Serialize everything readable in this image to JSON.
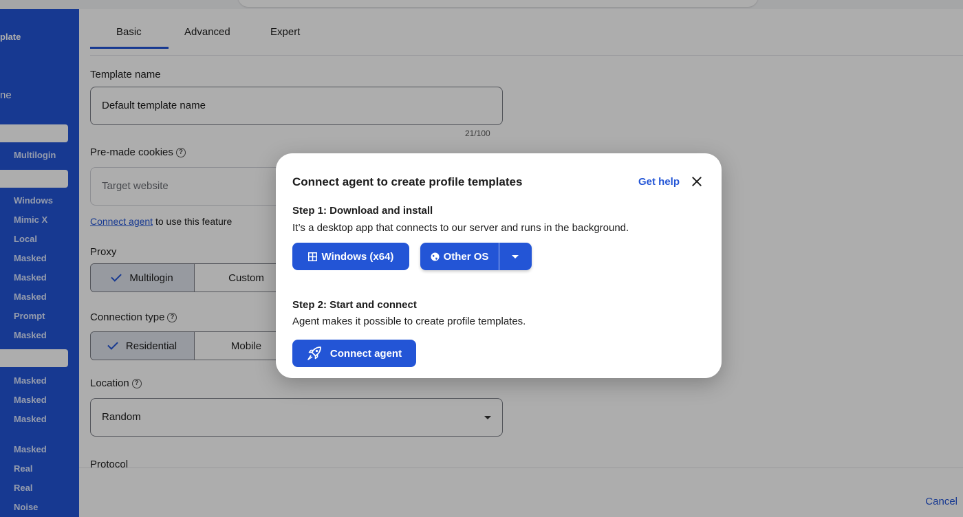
{
  "sidebar": {
    "top_label_1": "plate",
    "top_label_2": "ne",
    "items": [
      {
        "label": "Multilogin"
      },
      {
        "label": "Windows"
      },
      {
        "label": "Mimic X"
      },
      {
        "label": "Local"
      },
      {
        "label": "Masked"
      },
      {
        "label": "Masked"
      },
      {
        "label": "Masked"
      },
      {
        "label": "Prompt"
      },
      {
        "label": "Masked"
      },
      {
        "label": "Masked"
      },
      {
        "label": "Masked"
      },
      {
        "label": "Masked"
      },
      {
        "label": "Masked"
      },
      {
        "label": "Real"
      },
      {
        "label": "Real"
      },
      {
        "label": "Noise"
      }
    ]
  },
  "tabs": [
    {
      "label": "Basic"
    },
    {
      "label": "Advanced"
    },
    {
      "label": "Expert"
    }
  ],
  "form": {
    "template_name_label": "Template name",
    "template_name_value": "Default template name",
    "char_counter": "21/100",
    "cookies_label": "Pre-made cookies",
    "cookies_placeholder": "Target website",
    "connect_link": "Connect agent",
    "connect_suffix": "to use this feature",
    "proxy_label": "Proxy",
    "proxy_options": [
      "Multilogin",
      "Custom"
    ],
    "connection_label": "Connection type",
    "connection_options": [
      "Residential",
      "Mobile"
    ],
    "location_label": "Location",
    "location_value": "Random",
    "protocol_label": "Protocol",
    "help_glyph": "?"
  },
  "footer": {
    "cancel": "Cancel"
  },
  "modal": {
    "title": "Connect agent to create profile templates",
    "get_help": "Get help",
    "step1_title": "Step 1: Download and install",
    "step1_desc": "It’s a desktop app that connects to our server and runs in the background.",
    "windows_button": "Windows (x64)",
    "other_os_button": "Other OS",
    "step2_title": "Step 2: Start and connect",
    "step2_desc": "Agent makes it possible to create profile templates.",
    "connect_button": "Connect agent"
  },
  "colors": {
    "accent": "#2355d6",
    "overlay": "rgba(0,0,0,0.32)"
  },
  "icons": {
    "windows": "windows-icon",
    "globe": "globe-icon",
    "rocket": "rocket-icon",
    "close": "close-icon",
    "help": "help-circle-icon",
    "check": "check-icon",
    "caret": "chevron-down-icon"
  }
}
